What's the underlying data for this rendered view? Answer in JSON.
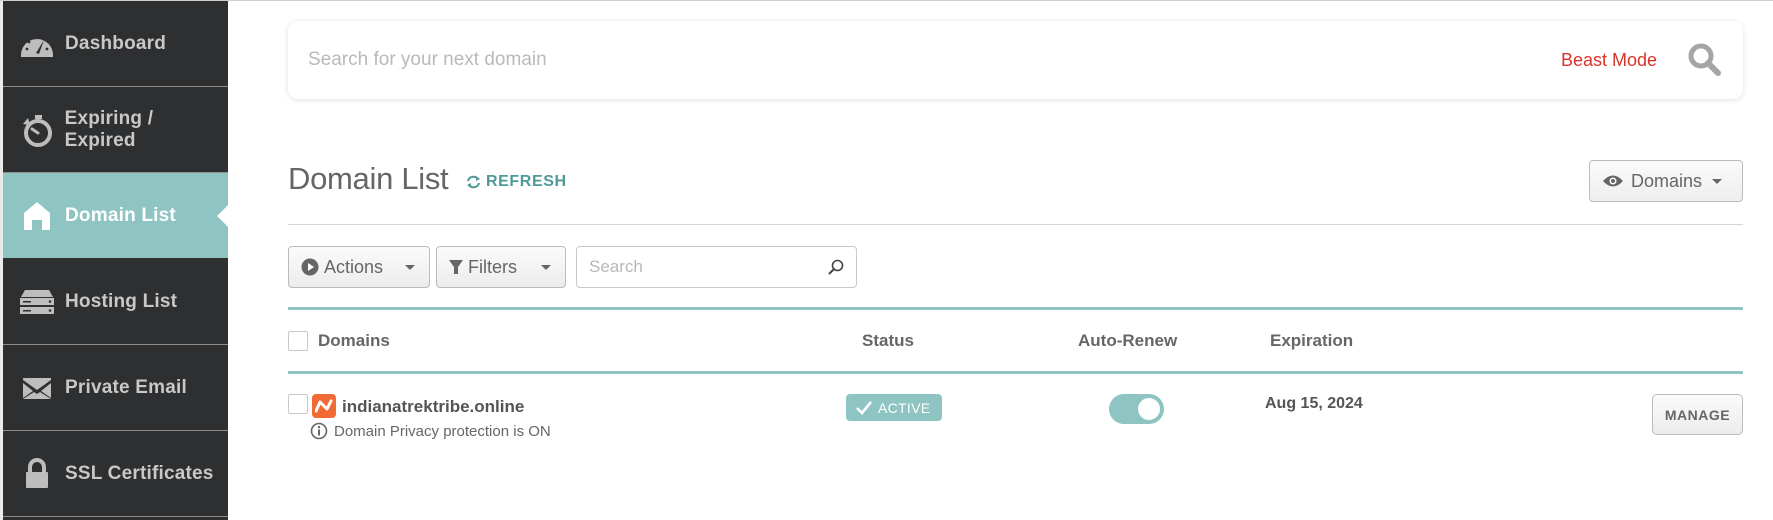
{
  "sidebar": {
    "items": [
      {
        "label": "Dashboard",
        "icon": "dashboard-gauge-icon",
        "active": false
      },
      {
        "label": "Expiring / Expired",
        "icon": "stopwatch-icon",
        "active": false
      },
      {
        "label": "Domain List",
        "icon": "home-icon",
        "active": true
      },
      {
        "label": "Hosting List",
        "icon": "server-icon",
        "active": false
      },
      {
        "label": "Private Email",
        "icon": "envelope-icon",
        "active": false
      },
      {
        "label": "SSL Certificates",
        "icon": "lock-icon",
        "active": false
      }
    ]
  },
  "top_search": {
    "placeholder": "Search for your next domain",
    "value": "",
    "beast_mode_label": "Beast Mode",
    "icon": "search-icon"
  },
  "header": {
    "title": "Domain List",
    "refresh_label": "REFRESH",
    "view_select_label": "Domains"
  },
  "toolbar": {
    "actions_label": "Actions",
    "filters_label": "Filters",
    "search_placeholder": "Search",
    "search_value": ""
  },
  "table": {
    "columns": [
      "Domains",
      "Status",
      "Auto-Renew",
      "Expiration"
    ],
    "rows": [
      {
        "domain": "indianatrektribe.online",
        "note": "Domain Privacy protection is ON",
        "status": "ACTIVE",
        "auto_renew": true,
        "expiration": "Aug 15, 2024",
        "action_label": "MANAGE"
      }
    ]
  },
  "colors": {
    "accent_teal": "#8ec5c3",
    "refresh_teal": "#4f9a96",
    "beast_mode_red": "#d9342b",
    "sidebar_bg": "#2e2f31",
    "favicon_orange": "#f26a34"
  }
}
